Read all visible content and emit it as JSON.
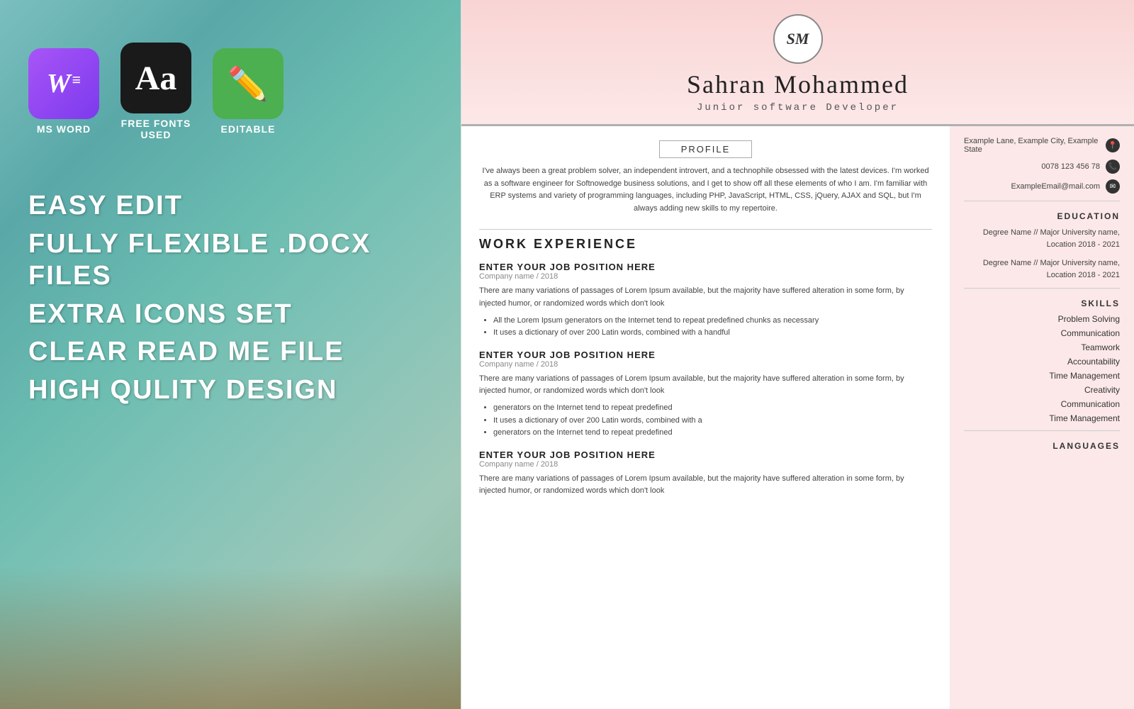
{
  "left": {
    "icons": [
      {
        "id": "word",
        "label": "MS WORD"
      },
      {
        "id": "font",
        "label": "FREE  FONTS\nUSED"
      },
      {
        "id": "edit",
        "label": "EDITABLE"
      }
    ],
    "features": [
      "EASY EDIT",
      "FULLY FLEXIBLE .DOCX FILES",
      "EXTRA ICONS SET",
      "CLEAR READ ME FILE",
      "HIGH QULITY DESIGN"
    ]
  },
  "resume": {
    "monogram": "SM",
    "name": "Sahran Mohammed",
    "title": "Junior software Developer",
    "profile_label": "PROFILE",
    "profile_text": "I've always been a great problem solver, an independent introvert, and a technophile obsessed with the latest devices.  I'm worked as a software engineer for Softnowedge business solutions, and I get to show off all these elements of who I am. I'm familiar with ERP systems and variety of programming languages, including PHP, JavaScript, HTML, CSS, jQuery, AJAX and SQL, but I'm always adding new skills to my repertoire.",
    "work_section_title": "WORK EXPERIENCE",
    "jobs": [
      {
        "title": "ENTER YOUR JOB POSITION HERE",
        "company": "Company name / 2018",
        "desc": "There are many variations of passages of Lorem Ipsum available, but the majority have suffered alteration in some form, by injected humor, or randomized words which don't look",
        "bullets": [
          "All the Lorem Ipsum generators on the Internet tend to repeat predefined chunks as necessary",
          "It uses a dictionary of over 200 Latin words, combined with a handful"
        ]
      },
      {
        "title": "ENTER YOUR JOB POSITION HERE",
        "company": "Company name / 2018",
        "desc": "There are many variations of passages of Lorem Ipsum available, but the majority have suffered alteration in some form, by injected humor, or randomized words which don't look",
        "bullets": [
          "generators on the Internet tend to repeat predefined",
          "It uses a dictionary of over 200 Latin words, combined with a",
          "generators on the Internet tend to repeat predefined"
        ]
      },
      {
        "title": "ENTER YOUR JOB POSITION HERE",
        "company": "Company name / 2018",
        "desc": "There are many variations of passages of Lorem Ipsum available, but the majority have suffered alteration in some form, by injected humor, or randomized words which don't look",
        "bullets": []
      }
    ],
    "contact": {
      "address": "Example Lane, Example City, Example State",
      "phone": "0078 123 456 78",
      "email": "ExampleEmail@mail.com"
    },
    "education_title": "EDUCATION",
    "education": [
      "Degree Name // Major University name, Location 2018 - 2021",
      "Degree Name // Major University name, Location 2018 - 2021"
    ],
    "skills_title": "SKILLS",
    "skills": [
      "Problem Solving",
      "Communication",
      "Teamwork",
      "Accountability",
      "Time Management",
      "Creativity",
      "Communication",
      "Time Management"
    ],
    "languages_title": "LANGUAGES"
  }
}
